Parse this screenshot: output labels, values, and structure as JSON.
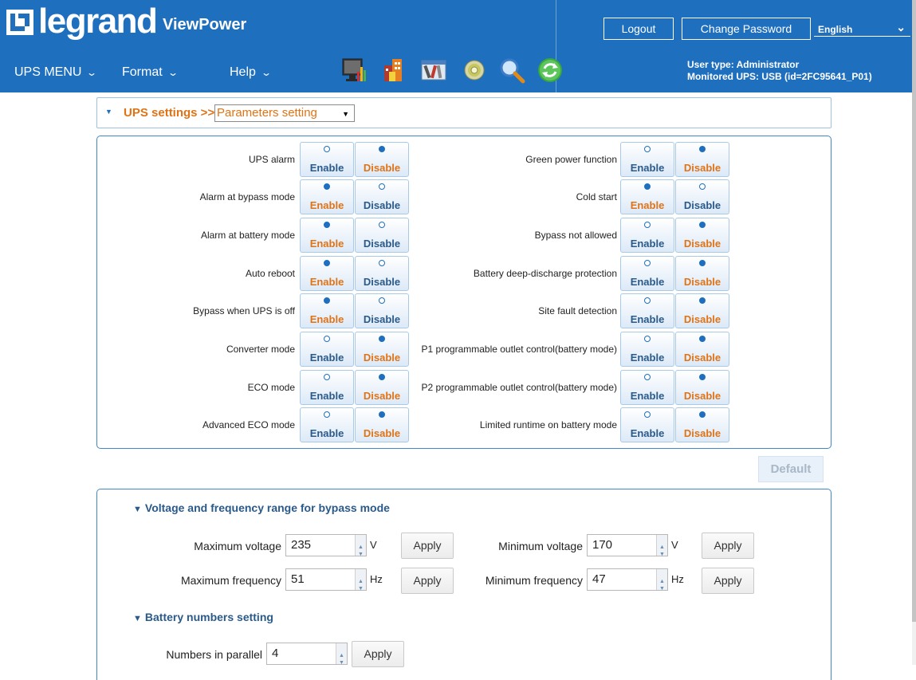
{
  "header": {
    "brand": "legrand",
    "app_name": "ViewPower",
    "logout_label": "Logout",
    "change_password_label": "Change Password",
    "language": "English",
    "user_type": "User type: Administrator",
    "monitored_ups": "Monitored UPS: USB (id=2FC95641_P01)",
    "colors": {
      "header_bg": "#1f6fbf",
      "accent": "#e07316"
    }
  },
  "menu": {
    "ups_menu": "UPS MENU",
    "format": "Format",
    "help": "Help"
  },
  "toolbar_icons": [
    "monitor-chart-icon",
    "buildings-icon",
    "tools-icon",
    "gear-disc-icon",
    "magnifier-icon",
    "refresh-icon"
  ],
  "title_bar": {
    "section": "UPS settings >>",
    "selected": "Parameters setting"
  },
  "settings": {
    "enable_label": "Enable",
    "disable_label": "Disable",
    "left": [
      {
        "label": "UPS alarm",
        "value": "Disable"
      },
      {
        "label": "Alarm at bypass mode",
        "value": "Enable"
      },
      {
        "label": "Alarm at battery mode",
        "value": "Enable"
      },
      {
        "label": "Auto reboot",
        "value": "Enable"
      },
      {
        "label": "Bypass when UPS is off",
        "value": "Enable"
      },
      {
        "label": "Converter mode",
        "value": "Disable"
      },
      {
        "label": "ECO mode",
        "value": "Disable"
      },
      {
        "label": "Advanced ECO mode",
        "value": "Disable"
      }
    ],
    "right": [
      {
        "label": "Green power function",
        "value": "Disable"
      },
      {
        "label": "Cold start",
        "value": "Enable"
      },
      {
        "label": "Bypass not allowed",
        "value": "Disable"
      },
      {
        "label": "Battery deep-discharge protection",
        "value": "Disable"
      },
      {
        "label": "Site fault detection",
        "value": "Disable"
      },
      {
        "label": "P1 programmable outlet control(battery mode)",
        "value": "Disable"
      },
      {
        "label": "P2 programmable outlet control(battery mode)",
        "value": "Disable"
      },
      {
        "label": "Limited runtime on battery mode",
        "value": "Disable"
      }
    ],
    "default_label": "Default"
  },
  "bypass": {
    "title": "Voltage and frequency range for bypass mode",
    "max_voltage_label": "Maximum voltage",
    "max_voltage": "235",
    "min_voltage_label": "Minimum voltage",
    "min_voltage": "170",
    "voltage_unit": "V",
    "max_freq_label": "Maximum frequency",
    "max_freq": "51",
    "min_freq_label": "Minimum frequency",
    "min_freq": "47",
    "freq_unit": "Hz",
    "apply_label": "Apply"
  },
  "battery": {
    "title": "Battery numbers setting",
    "parallel_label": "Numbers in parallel",
    "parallel_value": "4",
    "apply_label": "Apply"
  }
}
